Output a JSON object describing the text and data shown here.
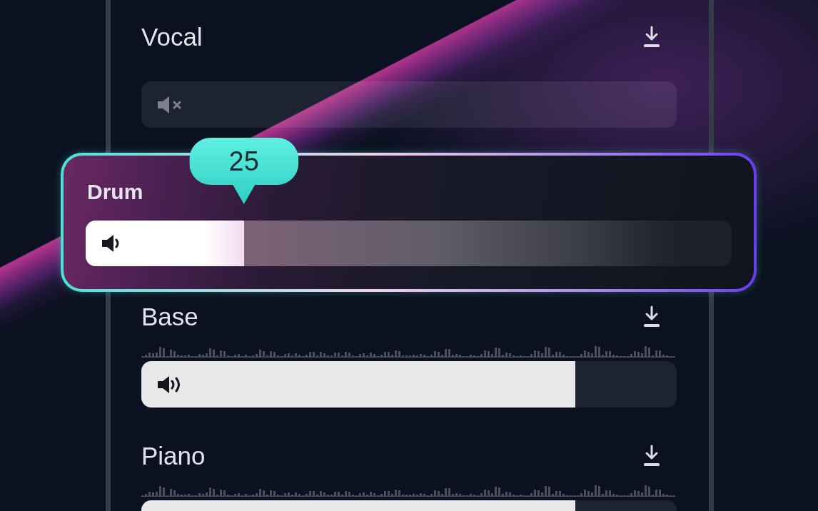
{
  "stems": [
    {
      "name": "Vocal",
      "selected": false,
      "muted": true,
      "waveform": false
    },
    {
      "name": "Drum",
      "selected": true,
      "muted": false,
      "level": 0.245,
      "waveform": false,
      "tooltip": "25"
    },
    {
      "name": "Base",
      "selected": false,
      "muted": false,
      "level": 0.81,
      "waveform": true
    },
    {
      "name": "Piano",
      "selected": false,
      "level": 0.81,
      "waveform": true
    }
  ]
}
